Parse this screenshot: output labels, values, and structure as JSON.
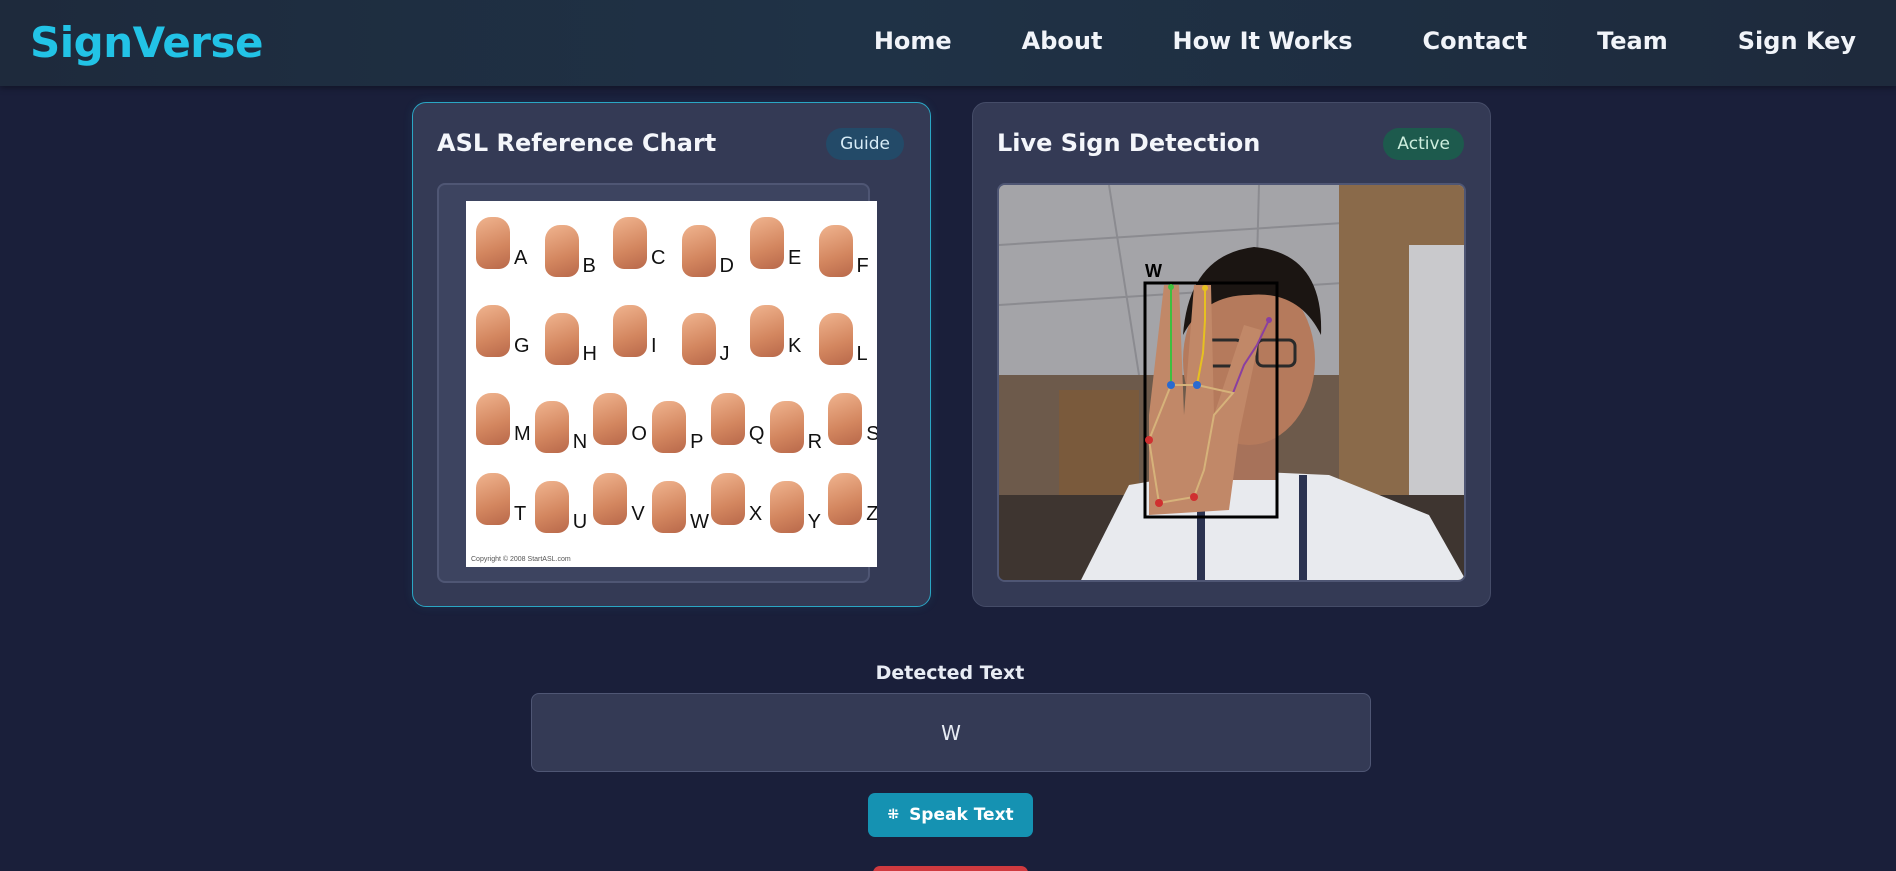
{
  "app": {
    "name": "SignVerse"
  },
  "nav": {
    "items": [
      {
        "label": "Home"
      },
      {
        "label": "About"
      },
      {
        "label": "How It Works"
      },
      {
        "label": "Contact"
      },
      {
        "label": "Team"
      },
      {
        "label": "Sign Key"
      }
    ]
  },
  "reference_card": {
    "title": "ASL Reference Chart",
    "badge": "Guide",
    "letters": [
      "A",
      "B",
      "C",
      "D",
      "E",
      "F",
      "G",
      "H",
      "I",
      "J",
      "K",
      "L",
      "M",
      "N",
      "O",
      "P",
      "Q",
      "R",
      "S",
      "T",
      "U",
      "V",
      "W",
      "X",
      "Y",
      "Z"
    ],
    "copyright": "Copyright © 2008 StartASL.com"
  },
  "detection_card": {
    "title": "Live Sign Detection",
    "badge": "Active",
    "overlay_letter": "W"
  },
  "output": {
    "label": "Detected Text",
    "value": "W"
  },
  "actions": {
    "speak_label": "Speak Text"
  },
  "colors": {
    "brand": "#22c3e6",
    "speak_button": "#1592b2",
    "clear_button": "#d03a3f",
    "badge_active": "#1d5a4d",
    "badge_guide": "#234a68"
  },
  "icons": {
    "speak": "sparkle-icon"
  }
}
